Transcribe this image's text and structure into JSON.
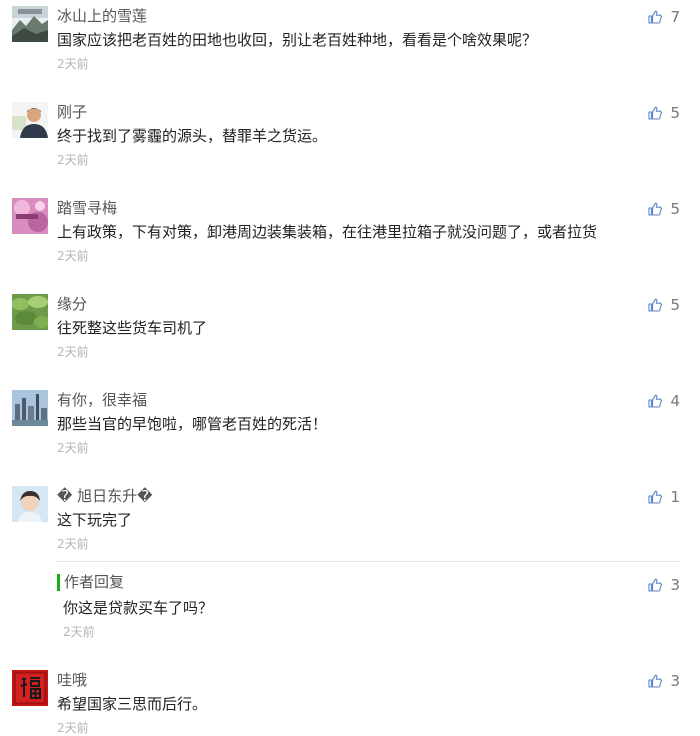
{
  "comments": [
    {
      "name": "冰山上的雪莲",
      "content": "国家应该把老百姓的田地也收回，别让老百姓种地，看看是个啥效果呢？",
      "time": "2天前",
      "likes": "7",
      "avatar": "landscape-banner"
    },
    {
      "name": "刚子",
      "content": "终于找到了雾霾的源头，替罪羊之货运。",
      "time": "2天前",
      "likes": "5",
      "avatar": "man-portrait"
    },
    {
      "name": "踏雪寻梅",
      "content": "上有政策，下有对策，卸港周边装集装箱，在往港里拉箱子就没问题了，或者拉货",
      "time": "2天前",
      "likes": "5",
      "avatar": "pink-flower"
    },
    {
      "name": "缘分",
      "content": "往死整这些货车司机了",
      "time": "2天前",
      "likes": "5",
      "avatar": "green-lotus"
    },
    {
      "name": "有你，很幸福",
      "content": "那些当官的早饱啦，哪管老百姓的死活！",
      "time": "2天前",
      "likes": "4",
      "avatar": "city-skyline"
    },
    {
      "name": "� 旭日东升�",
      "content": "这下玩完了",
      "time": "2天前",
      "likes": "1",
      "avatar": "child-portrait"
    },
    {
      "name": "哇哦",
      "content": "希望国家三思而后行。",
      "time": "2天前",
      "likes": "3",
      "avatar": "red-fu-character"
    }
  ],
  "author_reply": {
    "label": "作者回复",
    "content": "你这是贷款买车了吗？",
    "time": "2天前",
    "likes": "3",
    "accent_color": "#1aad19"
  },
  "icons": {
    "like": "thumbs-up-icon"
  },
  "colors": {
    "like_icon": "#5a84c8",
    "time_text": "#b3b3b3"
  }
}
